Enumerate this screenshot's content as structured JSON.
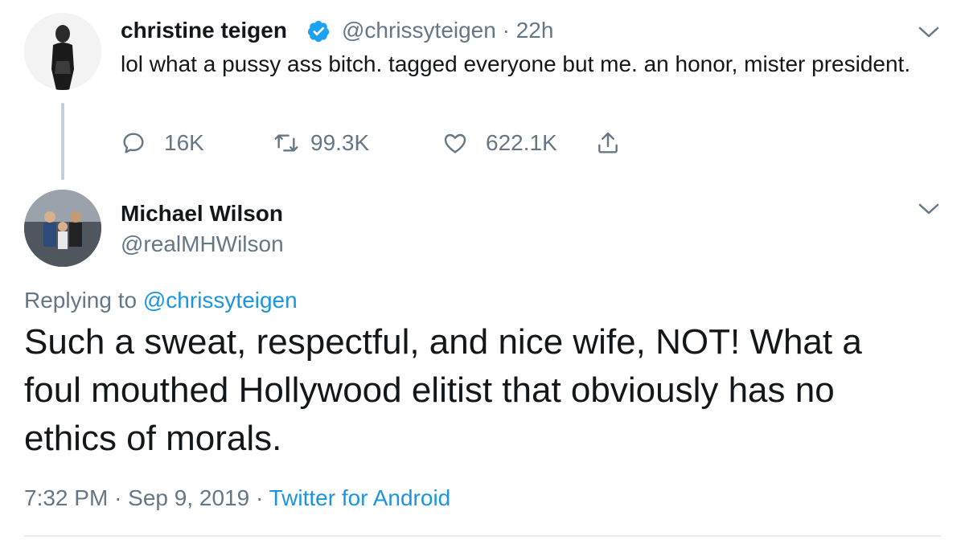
{
  "original_tweet": {
    "display_name": "christine teigen",
    "handle": "@chrissyteigen",
    "separator": "·",
    "time_ago": "22h",
    "text": "lol what a pussy ass bitch. tagged everyone but me. an honor, mister president.",
    "actions": {
      "replies": "16K",
      "retweets": "99.3K",
      "likes": "622.1K"
    },
    "icons": [
      "verified-badge-icon",
      "chevron-down-icon",
      "reply-icon",
      "retweet-icon",
      "like-icon",
      "share-icon"
    ]
  },
  "reply_tweet": {
    "display_name": "Michael Wilson",
    "handle": "@realMHWilson",
    "replying_prefix": "Replying to",
    "replying_to": "@chrissyteigen",
    "text": "Such a sweat, respectful, and nice wife, NOT! What a foul mouthed Hollywood elitist that obviously has no ethics of morals.",
    "time": "7:32 PM",
    "date": "Sep 9, 2019",
    "source": "Twitter for Android",
    "dot": "·"
  },
  "colors": {
    "text": "#14171a",
    "secondary_text": "#657786",
    "link": "#1b95e0",
    "verified": "#1da1f2",
    "thread_line": "#c4cfd6"
  }
}
